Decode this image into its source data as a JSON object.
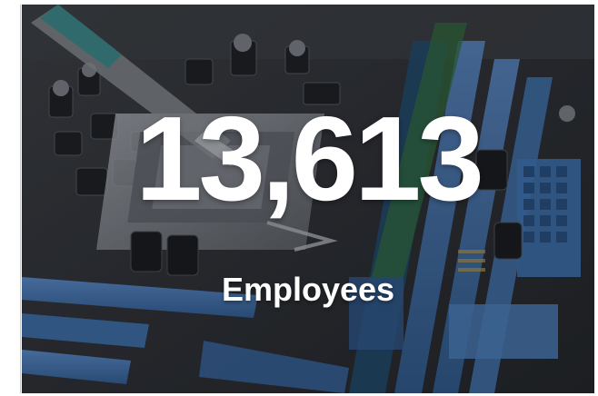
{
  "stat": {
    "value": "13,613",
    "label": "Employees"
  },
  "background": {
    "subject": "motherboard-photo",
    "colors": {
      "board": "#2a2d31",
      "slot_blue": "#3a6ea8",
      "slot_blue_light": "#4f86c2",
      "chip": "#1b1d20",
      "metal": "#9a9fa6",
      "text": "#ffffff"
    }
  }
}
